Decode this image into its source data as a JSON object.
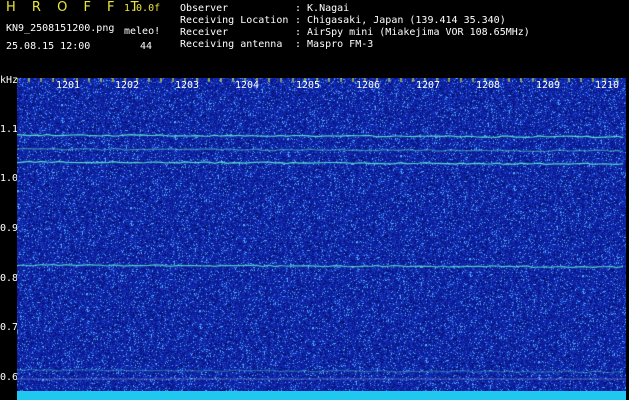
{
  "header": {
    "app_title": "H R O F F T",
    "version": "1.0.0f",
    "filename": "KN9_2508151200.png",
    "datetime": "25.08.15 12:00",
    "mode_label": "meleo!",
    "count_label": "44",
    "info": [
      {
        "key": "Observer",
        "value": ": K.Nagai"
      },
      {
        "key": "Receiving Location",
        "value": ": Chigasaki, Japan (139.414 35.340)"
      },
      {
        "key": "Receiver",
        "value": ": AirSpy mini (Miakejima VOR 108.65MHz)"
      },
      {
        "key": "Receiving antenna",
        "value": ": Maspro FM-3"
      }
    ]
  },
  "axis": {
    "y_unit": "kHz",
    "y_ticks": [
      "1.1",
      "1.0",
      "0.9",
      "0.8",
      "0.7",
      "0.6"
    ],
    "x_ticks": [
      "1201",
      "1202",
      "1203",
      "1204",
      "1205",
      "1206",
      "1207",
      "1208",
      "1209",
      "1210"
    ]
  },
  "colors": {
    "background": "#000000",
    "plot_base": "#0c1fa0",
    "noise_hi": "#4fb0ff",
    "signal": "#5ff0d0",
    "bottom_strip": "#20c8f0",
    "header_yellow": "#e8e83a"
  }
}
